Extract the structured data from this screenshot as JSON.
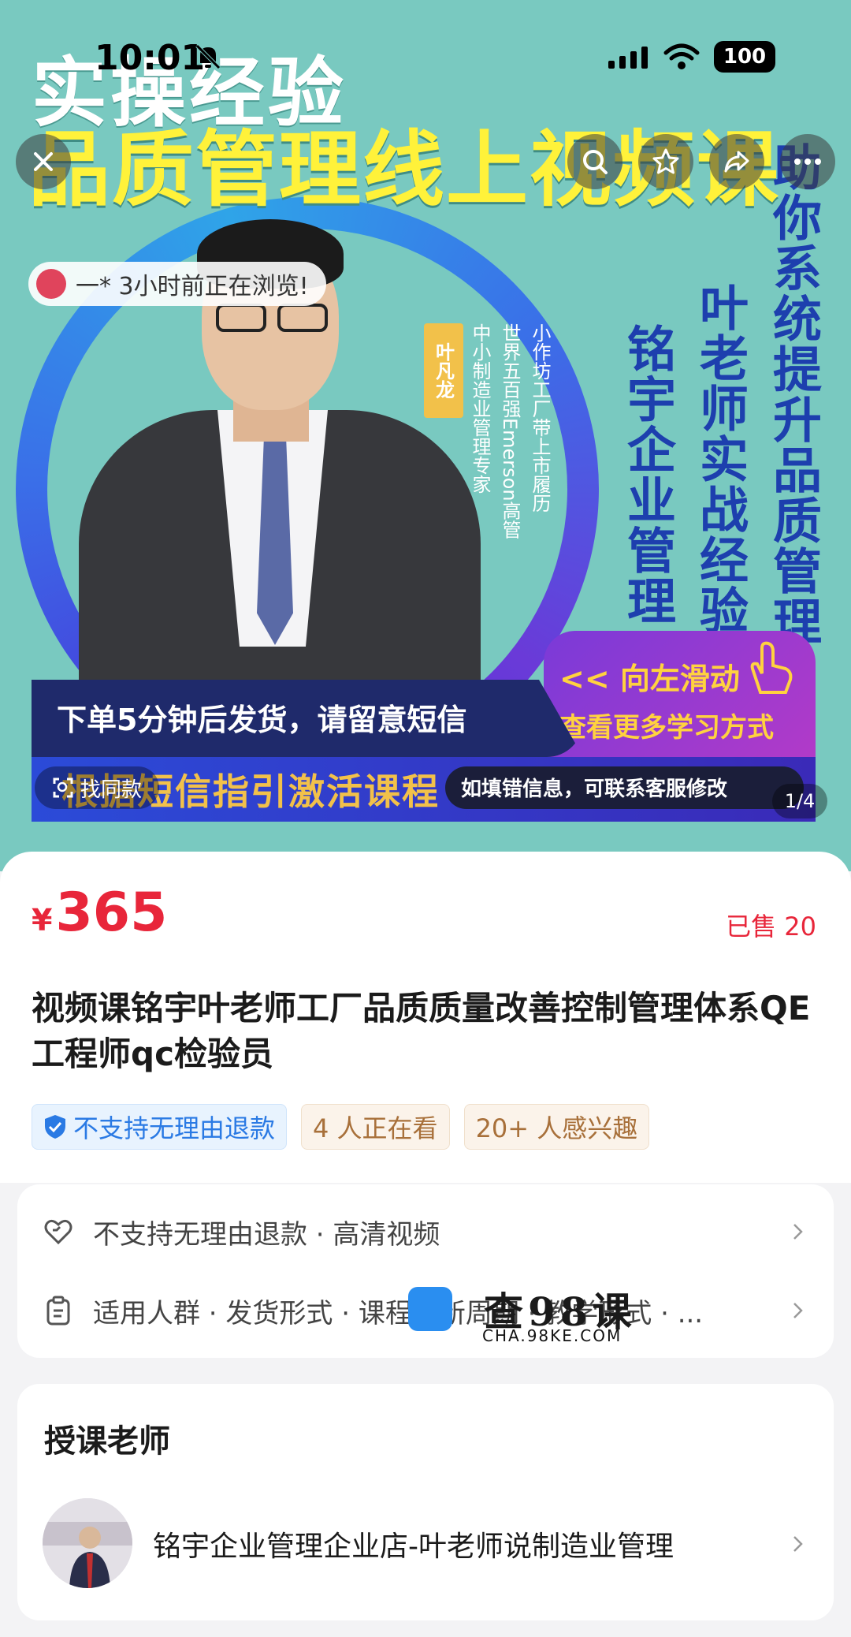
{
  "status_bar": {
    "time": "10:01",
    "battery": "100"
  },
  "hero": {
    "title_line1": "实操经验",
    "title_line2": "品质管理线上视频课",
    "col_right": "助你系统提升品质管理",
    "col_mid": "叶老师实战经验",
    "col_left": "铭宇企业管理",
    "name_tag": "叶凡龙",
    "bullets": [
      "小作坊工厂带上市履历",
      "世界五百强Emerson高管",
      "中小制造业管理专家"
    ],
    "swipe_line1": "<< 向左滑动",
    "swipe_line2": "查看更多学习方式",
    "banner_1": "下单5分钟后发货，请留意短信",
    "banner_2": "根据短信指引激活课程",
    "banner_3": "如填错信息，可联系客服修改",
    "browse_text": "一* 3小时前正在浏览!",
    "find_text": "找同款",
    "page_indicator": "1/4"
  },
  "product": {
    "price_symbol": "¥",
    "price": "365",
    "sold": "已售 20",
    "title": "视频课铭宇叶老师工厂品质质量改善控制管理体系QE工程师qc检验员",
    "tags": [
      "不支持无理由退款",
      "4 人正在看",
      "20+ 人感兴趣"
    ]
  },
  "info": {
    "row1": "不支持无理由退款 · 高清视频",
    "row2": "适用人群 · 发货形式 · 课程更新周期 · 教学形式 · ..."
  },
  "watermark": {
    "cn": "查98课",
    "en": "CHA.98KE.COM"
  },
  "teacher": {
    "heading": "授课老师",
    "name": "铭宇企业管理企业店-叶老师说制造业管理"
  },
  "colors": {
    "price_red": "#e8263a",
    "hero_bg": "#79c9c0",
    "title_yellow": "#fff23a",
    "deep_blue": "#1d3fae"
  }
}
